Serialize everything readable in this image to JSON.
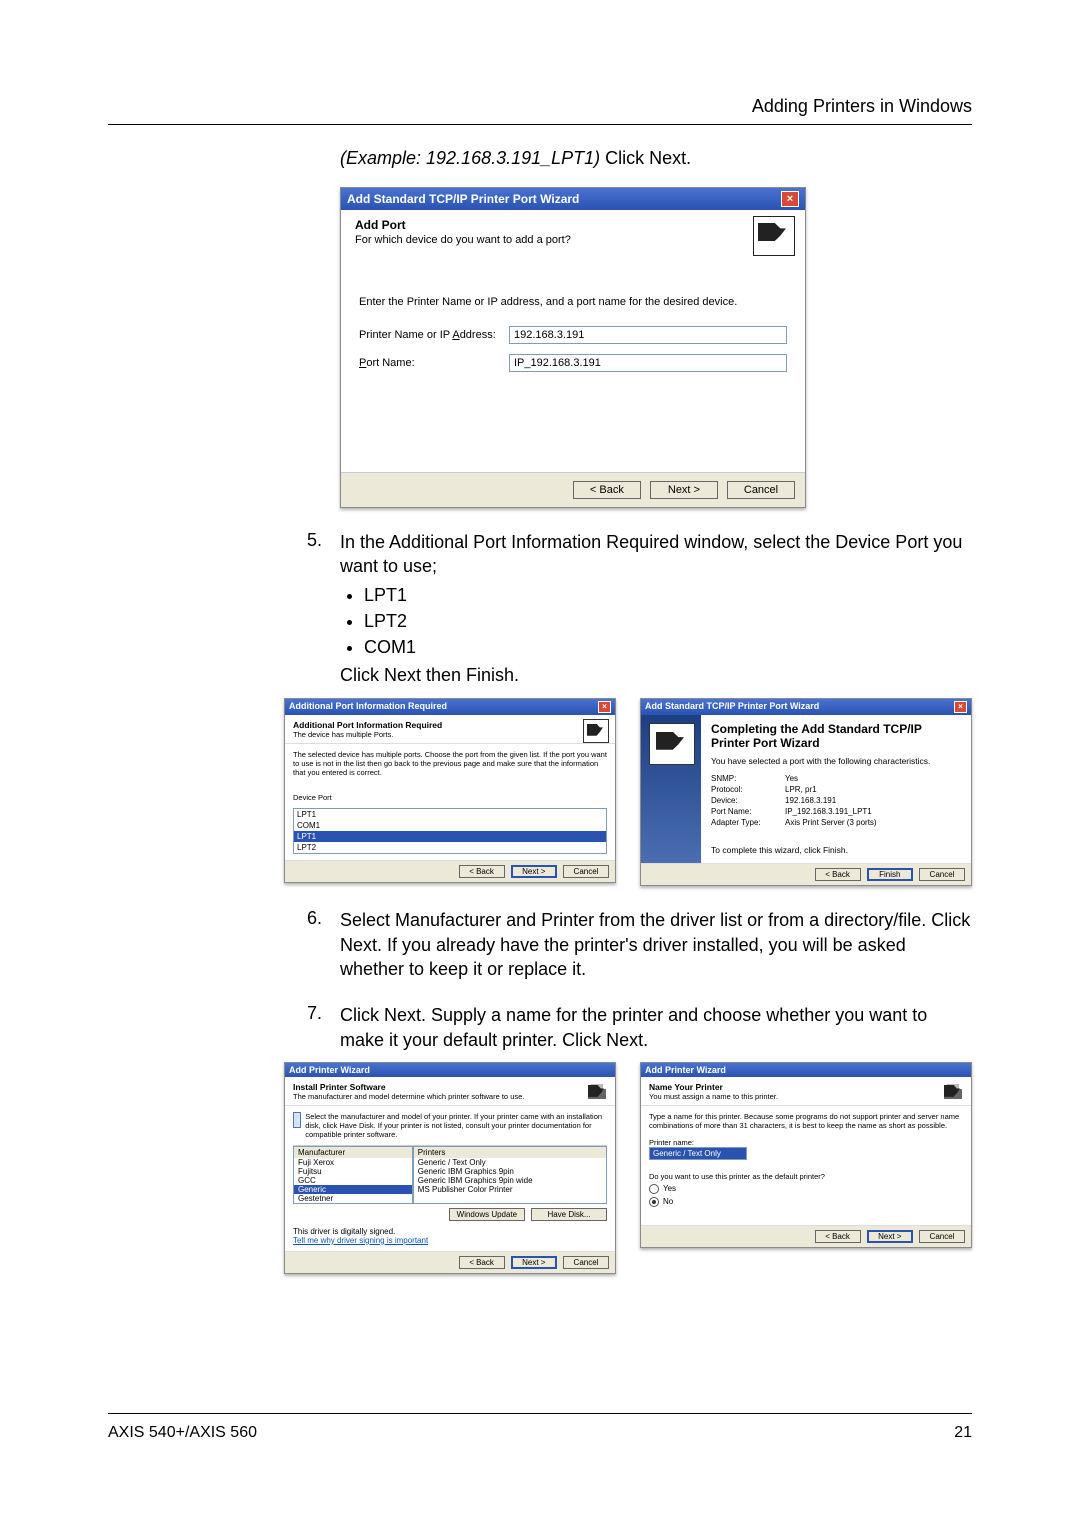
{
  "header": {
    "section_title": "Adding Printers in Windows",
    "page_number": "21",
    "footer_product": "AXIS 540+/AXIS 560"
  },
  "example_line": {
    "italic": "(Example: 192.168.3.191_LPT1) ",
    "rest": "Click Next."
  },
  "dialog_add_port": {
    "title": "Add Standard TCP/IP Printer Port Wizard",
    "heading": "Add Port",
    "subheading": "For which device do you want to add a port?",
    "note": "Enter the Printer Name or IP address, and a port name for the desired device.",
    "label_addr": "Printer Name or IP Address:",
    "label_port": "Port Name:",
    "value_addr": "192.168.3.191",
    "value_port": "IP_192.168.3.191",
    "btn_back": "< Back",
    "btn_next": "Next >",
    "btn_cancel": "Cancel"
  },
  "step5": {
    "num": "5.",
    "text": "In the Additional Port Information Required window, select the Device Port you want to use;",
    "bullets": [
      "LPT1",
      "LPT2",
      "COM1"
    ],
    "after": "Click Next then Finish."
  },
  "dlg_addl": {
    "title": "Additional Port Information Required",
    "h1": "Additional Port Information Required",
    "h2": "The device has multiple Ports.",
    "body": "The selected device has multiple ports. Choose the port from the given list. If the port you want to use is not in the list then go back to the previous page and make sure that the information that you entered is correct.",
    "label_dp": "Device Port",
    "list": [
      "LPT1",
      "COM1",
      "LPT1",
      "LPT2"
    ],
    "selected_idx": 2,
    "btn_back": "< Back",
    "btn_next": "Next >",
    "btn_cancel": "Cancel"
  },
  "dlg_complete": {
    "title": "Add Standard TCP/IP Printer Port Wizard",
    "big": "Completing the Add Standard TCP/IP Printer Port Wizard",
    "lead": "You have selected a port with the following characteristics.",
    "rows": [
      {
        "k": "SNMP:",
        "v": "Yes"
      },
      {
        "k": "Protocol:",
        "v": "LPR, pr1"
      },
      {
        "k": "Device:",
        "v": "192.168.3.191"
      },
      {
        "k": "Port Name:",
        "v": "IP_192.168.3.191_LPT1"
      },
      {
        "k": "Adapter Type:",
        "v": "Axis Print Server (3 ports)"
      }
    ],
    "tail": "To complete this wizard, click Finish.",
    "btn_back": "< Back",
    "btn_finish": "Finish",
    "btn_cancel": "Cancel"
  },
  "step6": {
    "num": "6.",
    "text": "Select Manufacturer and Printer from the driver list or from a directory/file. Click Next. If you already have the printer's driver installed, you will be asked whether to keep it or replace it."
  },
  "step7": {
    "num": "7.",
    "text": "Click Next. Supply a name for the printer and choose whether you want to make it your default printer. Click Next."
  },
  "dlg_install": {
    "title": "Add Printer Wizard",
    "h1": "Install Printer Software",
    "h2": "The manufacturer and model determine which printer software to use.",
    "body": "Select the manufacturer and model of your printer. If your printer came with an installation disk, click Have Disk. If your printer is not listed, consult your printer documentation for compatible printer software.",
    "mfr_head": "Manufacturer",
    "prn_head": "Printers",
    "mfr_list": [
      "Fuji Xerox",
      "Fujitsu",
      "GCC",
      "Generic",
      "Gestetner"
    ],
    "mfr_sel": 3,
    "prn_list": [
      "Generic / Text Only",
      "Generic IBM Graphics 9pin",
      "Generic IBM Graphics 9pin wide",
      "MS Publisher Color Printer"
    ],
    "signed": "This driver is digitally signed.",
    "signed_link": "Tell me why driver signing is important",
    "btn_wu": "Windows Update",
    "btn_hd": "Have Disk...",
    "btn_back": "< Back",
    "btn_next": "Next >",
    "btn_cancel": "Cancel"
  },
  "dlg_name": {
    "title": "Add Printer Wizard",
    "h1": "Name Your Printer",
    "h2": "You must assign a name to this printer.",
    "body": "Type a name for this printer. Because some programs do not support printer and server name combinations of more than 31 characters, it is best to keep the name as short as possible.",
    "label_name": "Printer name:",
    "value_name": "Generic / Text Only",
    "q": "Do you want to use this printer as the default printer?",
    "opt_yes": "Yes",
    "opt_no": "No",
    "selected": "no",
    "btn_back": "< Back",
    "btn_next": "Next >",
    "btn_cancel": "Cancel"
  }
}
